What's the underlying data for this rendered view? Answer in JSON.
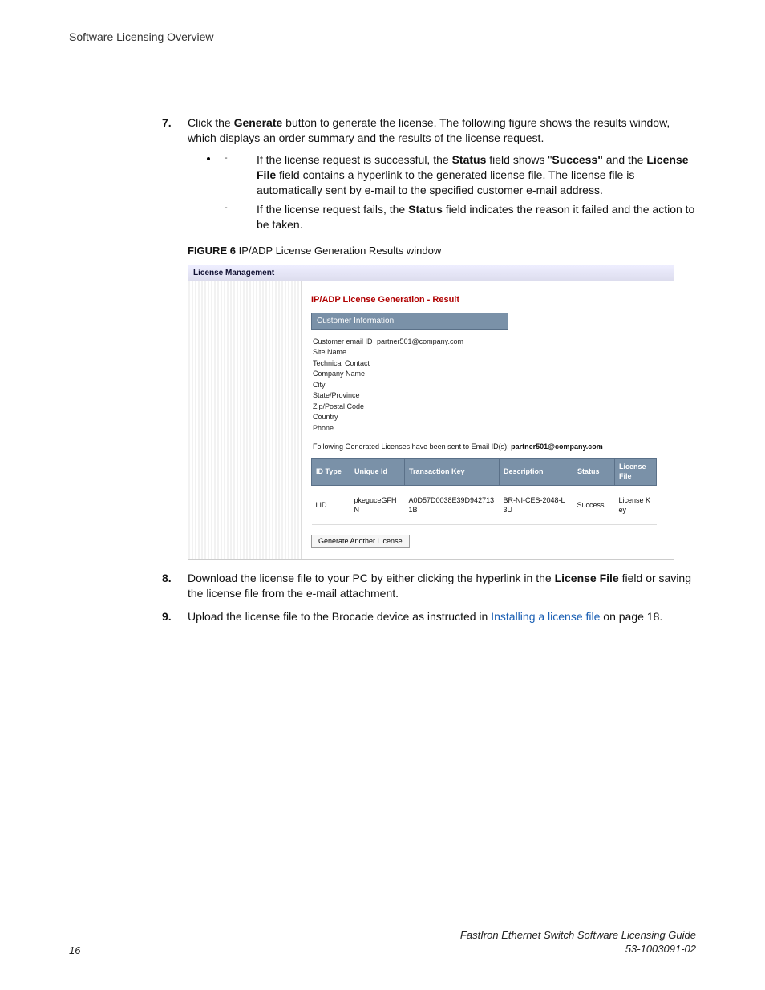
{
  "header": {
    "title": "Software Licensing Overview"
  },
  "steps": {
    "n7": "7.",
    "s7a": "Click the ",
    "s7b": "Generate",
    "s7c": " button to generate the license. The following figure shows the results window, which displays an order summary and the results of the license request.",
    "bul1a": "If the license request is successful, the ",
    "bul1b": "Status",
    "bul1c": " field shows \"",
    "bul1d": "Success\"",
    "bul1e": " and the ",
    "bul1f": "License File",
    "bul1g": " field contains a hyperlink to the generated license file. The license file is automatically sent by e-mail to the specified customer e-mail address.",
    "bul2a": "If the license request fails, the ",
    "bul2b": "Status",
    "bul2c": " field indicates the reason it failed and the action to be taken.",
    "figcap_a": "FIGURE 6",
    "figcap_b": " IP/ADP License Generation Results window",
    "n8": "8.",
    "s8a": "Download the license file to your PC by either clicking the hyperlink in the ",
    "s8b": "License File",
    "s8c": " field or saving the license file from the e-mail attachment.",
    "n9": "9.",
    "s9a": "Upload the license file to the Brocade device as instructed in ",
    "s9b": "Installing a license file",
    "s9c": " on page 18."
  },
  "screenshot": {
    "window_title": "License Management",
    "page_title": "IP/ADP License Generation - Result",
    "custinfo_header": "Customer Information",
    "fields": {
      "email_label": "Customer email ID",
      "email_val": "partner501@company.com",
      "site": "Site Name",
      "tech": "Technical Contact",
      "company": "Company Name",
      "city": "City",
      "state": "State/Province",
      "zip": "Zip/Postal Code",
      "country": "Country",
      "phone": "Phone"
    },
    "sent_a": "Following Generated Licenses have been sent to Email ID(s): ",
    "sent_b": "partner501@company.com",
    "th": {
      "id_type": "ID Type",
      "unique_id": "Unique Id",
      "txn": "Transaction Key",
      "desc": "Description",
      "status": "Status",
      "file": "License File"
    },
    "row": {
      "id_type": "LID",
      "unique_id": "pkeguceGFHN",
      "txn": "A0D57D0038E39D9427131B",
      "desc": "BR-NI-CES-2048-L3U",
      "status": "Success",
      "file": "License Key"
    },
    "gen_btn": "Generate Another License"
  },
  "footer": {
    "page": "16",
    "guide": "FastIron Ethernet Switch Software Licensing Guide",
    "docnum": "53-1003091-02"
  }
}
